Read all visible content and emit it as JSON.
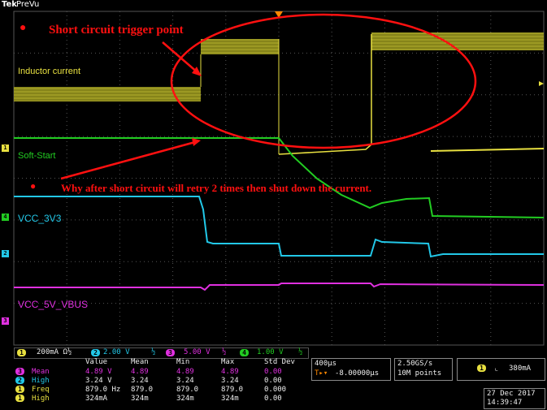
{
  "header": {
    "logo": "Tek",
    "mode": "PreVu"
  },
  "annotations": {
    "trigger_text": "Short circuit trigger point",
    "question_text": "Why after short circuit will retry 2 times then shut down the current.",
    "bullet": "●"
  },
  "traces": {
    "inductor": {
      "label": "Inductor current",
      "color": "#e8e040"
    },
    "softstart": {
      "label": "Soft-Start",
      "color": "#22cc22"
    },
    "vcc3v3": {
      "label": "VCC_3V3",
      "color": "#22c8e8"
    },
    "vcc5v": {
      "label": "VCC_5V_VBUS",
      "color": "#e030e0"
    }
  },
  "channel_markers": [
    "1",
    "4",
    "2",
    "3"
  ],
  "scales": {
    "ch1": {
      "num": "1",
      "value": "200mA Ω½"
    },
    "ch2": {
      "num": "2",
      "value": "2.00 V"
    },
    "ch3": {
      "num": "3",
      "value": "5.00 V"
    },
    "ch4": {
      "num": "4",
      "value": "1.00 V"
    },
    "bw": "½"
  },
  "measurements": {
    "headers": [
      "Value",
      "Mean",
      "Min",
      "Max",
      "Std Dev"
    ],
    "rows": [
      {
        "ch": "3",
        "name": "Mean",
        "color": "#e030e0",
        "value": "4.89 V",
        "mean": "4.89",
        "min": "4.89",
        "max": "4.89",
        "std": "0.00"
      },
      {
        "ch": "2",
        "name": "High",
        "color": "#22c8e8",
        "value": "3.24 V",
        "mean": "3.24",
        "min": "3.24",
        "max": "3.24",
        "std": "0.00"
      },
      {
        "ch": "1",
        "name": "Freq",
        "color": "#e8e040",
        "value": "879.0 Hz",
        "mean": "879.0",
        "min": "879.0",
        "max": "879.0",
        "std": "0.000"
      },
      {
        "ch": "1",
        "name": "High",
        "color": "#e8e040",
        "value": "324mA",
        "mean": "324m",
        "min": "324m",
        "max": "324m",
        "std": "0.00"
      }
    ]
  },
  "horizontal": {
    "timebase": "400µs",
    "position": "-8.00000µs"
  },
  "acquisition": {
    "rate": "2.50GS/s",
    "points": "10M points"
  },
  "trigger": {
    "channel": "1",
    "slope": "⌞",
    "level": "380mA"
  },
  "datetime": {
    "date": "27 Dec 2017",
    "time": "14:39:47"
  }
}
